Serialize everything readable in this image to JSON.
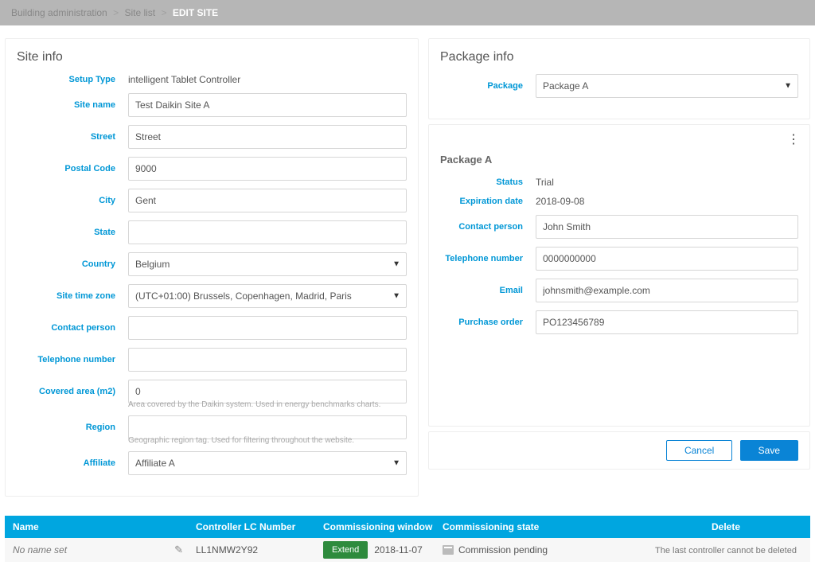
{
  "breadcrumb": {
    "item1": "Building administration",
    "item2": "Site list",
    "current": "EDIT SITE"
  },
  "sep": ">",
  "site_info_title": "Site info",
  "site": {
    "setup_type_label": "Setup Type",
    "setup_type_value": "intelligent Tablet Controller",
    "site_name_label": "Site name",
    "site_name_value": "Test Daikin Site A",
    "street_label": "Street",
    "street_value": "Street",
    "postal_label": "Postal Code",
    "postal_value": "9000",
    "city_label": "City",
    "city_value": "Gent",
    "state_label": "State",
    "state_value": "",
    "country_label": "Country",
    "country_value": "Belgium",
    "tz_label": "Site time zone",
    "tz_value": "(UTC+01:00) Brussels, Copenhagen, Madrid, Paris",
    "contact_label": "Contact person",
    "contact_value": "",
    "tel_label": "Telephone number",
    "tel_value": "",
    "area_label": "Covered area (m2)",
    "area_value": "0",
    "area_help": "Area covered by the Daikin system. Used in energy benchmarks charts.",
    "region_label": "Region",
    "region_value": "",
    "region_help": "Geographic region tag. Used for filtering throughout the website.",
    "affiliate_label": "Affiliate",
    "affiliate_value": "Affiliate A"
  },
  "package_info_title": "Package info",
  "package_select_label": "Package",
  "package_select_value": "Package A",
  "package_detail_name": "Package A",
  "pkg": {
    "status_label": "Status",
    "status_value": "Trial",
    "exp_label": "Expiration date",
    "exp_value": "2018-09-08",
    "contact_label": "Contact person",
    "contact_value": "John Smith",
    "tel_label": "Telephone number",
    "tel_value": "0000000000",
    "email_label": "Email",
    "email_value": "johnsmith@example.com",
    "po_label": "Purchase order",
    "po_value": "PO123456789"
  },
  "actions": {
    "cancel": "Cancel",
    "save": "Save"
  },
  "controllers": {
    "head_name": "Name",
    "head_lc": "Controller LC Number",
    "head_win": "Commissioning window",
    "head_state": "Commissioning state",
    "head_del": "Delete",
    "row": {
      "name": "No name set",
      "lc": "LL1NMW2Y92",
      "extend": "Extend",
      "win_date": "2018-11-07",
      "state": "Commission pending",
      "del_note": "The last controller cannot be deleted"
    }
  }
}
